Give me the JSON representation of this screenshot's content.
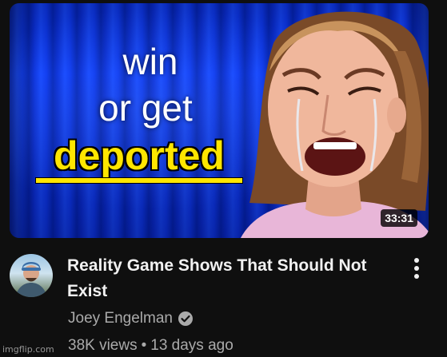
{
  "video": {
    "thumbnail": {
      "text_line1": "win",
      "text_line2": "or get",
      "text_line3": "deported",
      "duration": "33:31",
      "colors": {
        "background": "#1648ff",
        "highlight_text": "#ffe600"
      }
    },
    "title": "Reality Game Shows That Should Not Exist",
    "channel": {
      "name": "Joey Engelman",
      "verified_icon": "verified-check-icon"
    },
    "views": "38K views",
    "separator": "•",
    "age": "13 days ago",
    "menu_icon": "more-vert-icon"
  },
  "watermark": "imgflip.com"
}
